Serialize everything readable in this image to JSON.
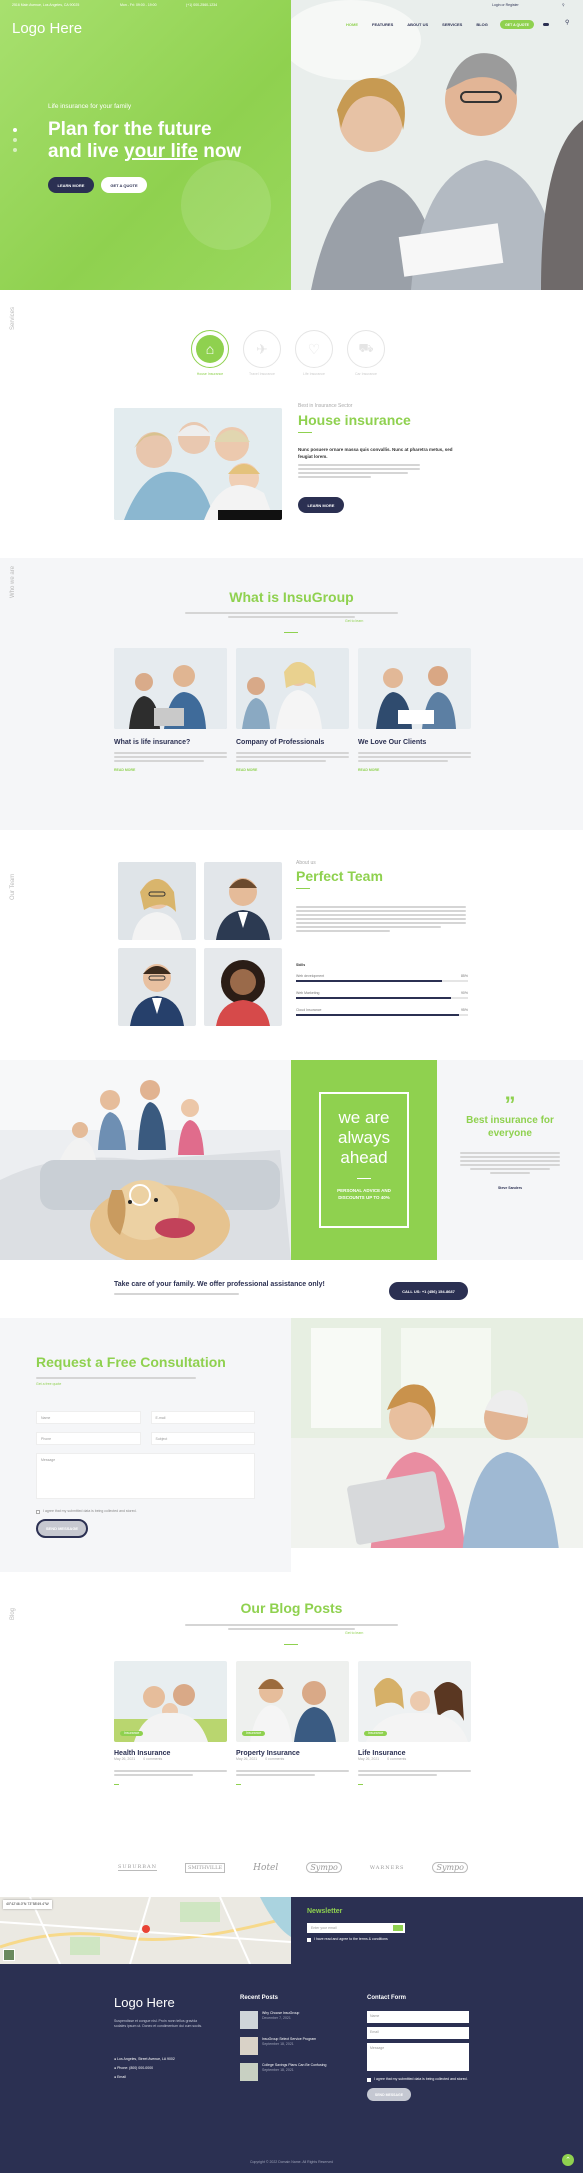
{
  "colors": {
    "accent": "#8fd14f",
    "navy": "#2b3052",
    "light": "#f5f6f8"
  },
  "topbar": {
    "address": "2516 Main Avenue, Los Angeles, CA 90025",
    "hours": "Mon - Fri: 09:00 - 19:00",
    "phone": "(+1)  000-2560-1234",
    "login": "Login or Register"
  },
  "hero": {
    "logo": "Logo Here",
    "nav": [
      "HOME",
      "FEATURES",
      "ABOUT US",
      "SERVICES",
      "BLOG"
    ],
    "quote_btn": "GET A QUOTE",
    "eyebrow": "Life insurance for your family",
    "title_line1": "Plan for the future",
    "title_line2_a": "and live ",
    "title_line2_b": "your life",
    "title_line2_c": " now",
    "btn_learn": "LEARN MORE",
    "btn_quote": "GET A QUOTE"
  },
  "services": {
    "side_label": "Services",
    "items": [
      "House Insurance",
      "Travel Insurance",
      "Life Insurance",
      "Car Insurance"
    ],
    "eyebrow": "Best in Insurance Sector",
    "title": "House insurance",
    "bold_text": "Nunc posuere ornare massa quis convallis. Nunc at pharetra metus, sed feugiat lorem.",
    "btn": "LEARN MORE"
  },
  "about": {
    "side_label": "Who we are",
    "title": "What is InsuGroup",
    "intro_link": "Get to learn",
    "cards": [
      {
        "title": "What is life insurance?",
        "more": "READ MORE"
      },
      {
        "title": "Company of Professionals",
        "more": "READ MORE"
      },
      {
        "title": "We Love Our Clients",
        "more": "READ MORE"
      }
    ]
  },
  "team": {
    "side_label": "Our Team",
    "eyebrow": "About us",
    "title": "Perfect Team",
    "skills_label": "Skills",
    "bars": [
      {
        "label": "Web development",
        "value": 85,
        "shown": "85%"
      },
      {
        "label": "Web Marketing",
        "value": 90,
        "shown": "90%"
      },
      {
        "label": "Cloud Insurance",
        "value": 95,
        "shown": "95%"
      }
    ]
  },
  "banner": {
    "headline": [
      "we are",
      "always",
      "ahead"
    ],
    "sub": "PERSONAL ADVICE AND DISCOUNTS UP TO 40%",
    "quote_mark": "”",
    "side_title": "Best insurance for everyone",
    "author": "Steve Sanders"
  },
  "cta": {
    "title": "Take care of your family. We offer professional assistance only!",
    "btn": "CALL US: +1 (456) 154-8687"
  },
  "consult": {
    "title": "Request a Free Consultation",
    "link": "Get a free quote",
    "fields": {
      "name": "Name",
      "email": "E-mail",
      "phone": "Phone",
      "subject": "Subject",
      "message": "Message"
    },
    "agree": "I agree that my submitted data is being collected and stored.",
    "btn": "SEND MESSAGE"
  },
  "blog": {
    "side_label": "Blog",
    "title": "Our Blog Posts",
    "link": "Get to learn",
    "posts": [
      {
        "title": "Health Insurance",
        "date": "May 26, 2021",
        "comments": "0 comments",
        "tag": "Insurance"
      },
      {
        "title": "Property Insurance",
        "date": "May 26, 2021",
        "comments": "0 comments",
        "tag": "Insurance"
      },
      {
        "title": "Life Insurance",
        "date": "May 26, 2021",
        "comments": "0 comments",
        "tag": "Insurance"
      }
    ]
  },
  "logos": [
    "SUBURBAN",
    "SMITHVILLE",
    "Hotel",
    "Sympo",
    "WARNERS",
    "Sympo"
  ],
  "newsletter": {
    "title": "Newsletter",
    "placeholder": "Enter your email",
    "agree": "I have read and agree to the terms & conditions",
    "map_coords": "40°42'46.0\"N 73°58'49.4\"W"
  },
  "footer": {
    "logo": "Logo Here",
    "about": "Suspendisse et congue nisl. Proin nonn tellus gravida sodales ipsum ut. Donec et condimentum dui cum sociis.",
    "address": "Los Angeles, Street Avenue, LA 9002",
    "phone": "Phone: (800) 000-0000",
    "email": "Email",
    "recent_title": "Recent Posts",
    "recent": [
      {
        "title": "Why Choose InsuGroup",
        "date": "December 7, 2021"
      },
      {
        "title": "InsuGroup Select Service Program",
        "date": "September 18, 2021"
      },
      {
        "title": "College Savings Plans Can Be Confusing",
        "date": "September 18, 2021"
      }
    ],
    "contact_title": "Contact Form",
    "name": "Name",
    "message": "Message",
    "agree": "I agree that my submitted data is being collected and stored.",
    "btn": "SEND MESSAGE",
    "copyright": "Copyright © 2022 Domain Name. All Rights Reserved"
  }
}
